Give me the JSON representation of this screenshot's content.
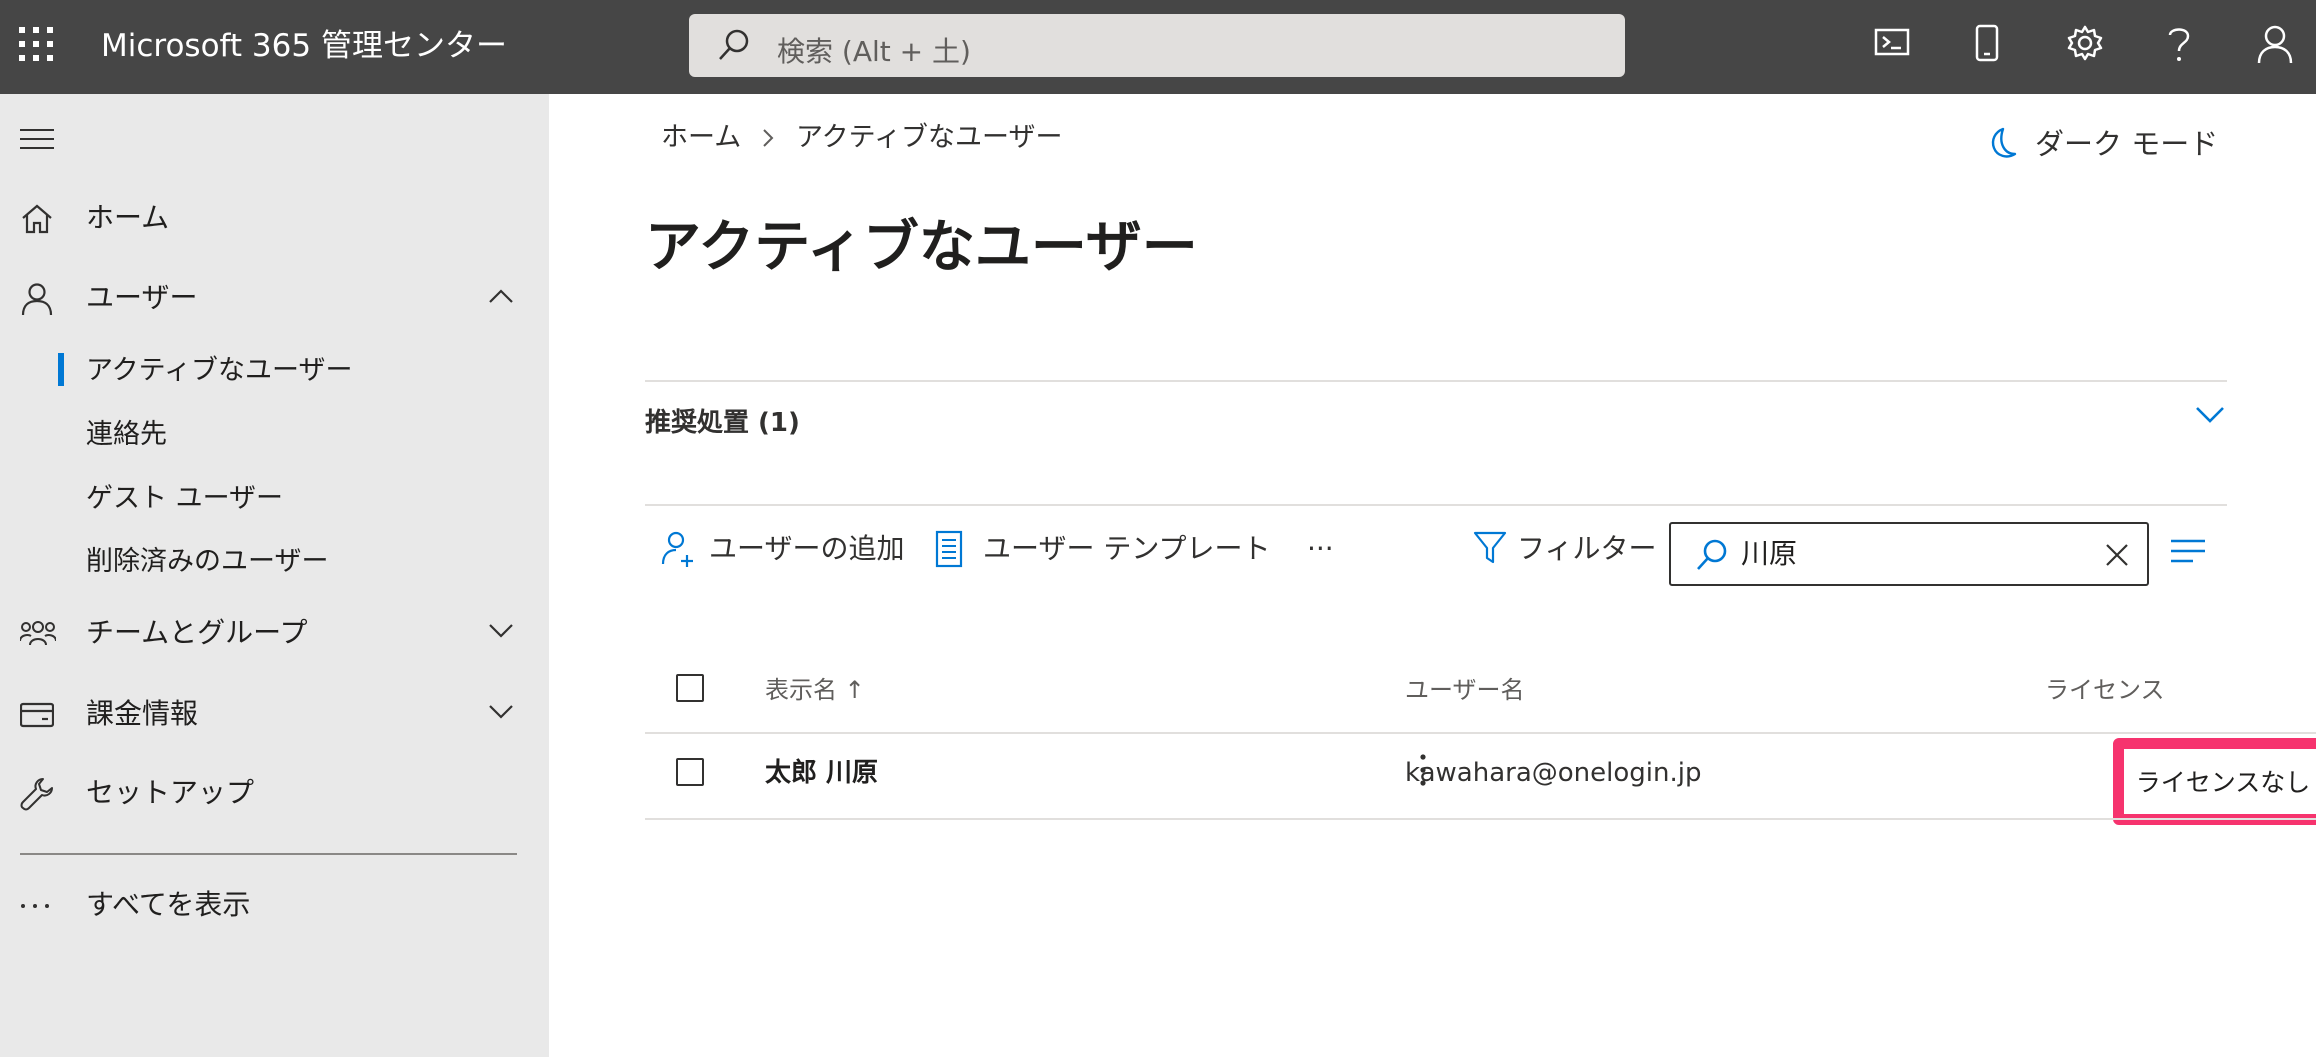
{
  "topbar": {
    "app_title": "Microsoft 365 管理センター",
    "search_placeholder": "検索 (Alt + 土)",
    "icons": [
      "app-launcher-icon",
      "console-icon",
      "mobile-icon",
      "settings-icon",
      "help-icon",
      "account-icon"
    ]
  },
  "sidebar": {
    "items": [
      {
        "label": "ホーム",
        "icon": "home-icon"
      },
      {
        "label": "ユーザー",
        "icon": "user-icon",
        "expanded": true,
        "children": [
          {
            "label": "アクティブなユーザー",
            "selected": true
          },
          {
            "label": "連絡先"
          },
          {
            "label": "ゲスト ユーザー"
          },
          {
            "label": "削除済みのユーザー"
          }
        ]
      },
      {
        "label": "チームとグループ",
        "icon": "people-icon"
      },
      {
        "label": "課金情報",
        "icon": "billing-card-icon"
      },
      {
        "label": "セットアップ",
        "icon": "wrench-icon"
      }
    ],
    "show_all": "すべてを表示"
  },
  "main": {
    "breadcrumb": [
      "ホーム",
      "アクティブなユーザー"
    ],
    "dark_mode": "ダーク モード",
    "page_title": "アクティブなユーザー",
    "recommendations": "推奨処置 (1)",
    "toolbar": {
      "add_user": "ユーザーの追加",
      "user_template": "ユーザー テンプレート",
      "more": "···",
      "filter": "フィルター",
      "search_value": "川原"
    },
    "table": {
      "columns": [
        "表示名 ↑",
        "ユーザー名",
        "ライセンス"
      ],
      "rows": [
        {
          "display_name": "太郎 川原",
          "user_name": "kawahara@onelogin.jp",
          "license": "ライセンスなし"
        }
      ]
    },
    "accent_color": "#0078d4",
    "highlight_color": "#f6336e"
  }
}
